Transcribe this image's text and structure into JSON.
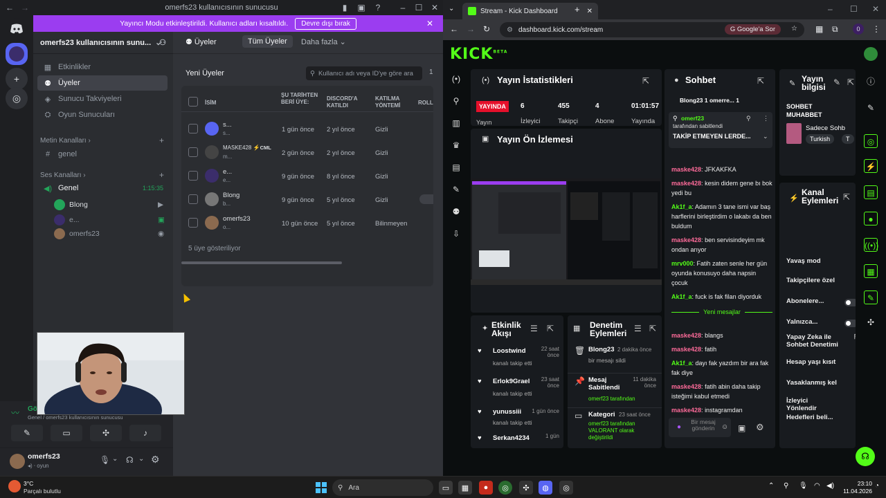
{
  "discord": {
    "window_title": "omerfs23 kullanıcısının sunucusu",
    "banner": {
      "text": "Yayıncı Modu etkinleştirildi. Kullanıcı adları kısaltıldı.",
      "button": "Devre dışı bırak"
    },
    "server_name": "omerfs23 kullanıcısının sunu...",
    "nav": [
      "Etkinlikler",
      "Üyeler",
      "Sunucu Takviyeleri",
      "Oyun Sunucuları"
    ],
    "text_category": "Metin Kanalları",
    "text_channel": "genel",
    "voice_category": "Ses Kanalları",
    "voice_channel": "Genel",
    "voice_time": "1:15:35",
    "voice_users": [
      "Blong",
      "e...",
      "omerfs23"
    ],
    "tabs": {
      "members": "Üyeler",
      "all": "Tüm Üyeler",
      "more": "Daha fazla"
    },
    "members_title": "Yeni Üyeler",
    "search_placeholder": "Kullanıcı adı veya ID'ye göre ara",
    "columns": {
      "name": "İSİM",
      "joined": "ŞU TARİHTEN BERİ ÜYE:",
      "discord": "DISCORD'A KATILDI",
      "method": "KATILMA YÖNTEMİ",
      "roles": "ROLL"
    },
    "members": [
      {
        "name": "s...",
        "sub": "s...",
        "joined": "1 gün önce",
        "discord": "2 yıl önce",
        "method": "Gizli"
      },
      {
        "name": "MASKE428",
        "sub": "m...",
        "tag": "CML",
        "joined": "2 gün önce",
        "discord": "2 yıl önce",
        "method": "Gizli"
      },
      {
        "name": "e...",
        "sub": "e...",
        "joined": "9 gün önce",
        "discord": "8 yıl önce",
        "method": "Gizli"
      },
      {
        "name": "Blong",
        "sub": "b...",
        "joined": "9 gün önce",
        "discord": "5 yıl önce",
        "method": "Gizli"
      },
      {
        "name": "omerfs23",
        "sub": "o...",
        "joined": "10 gün önce",
        "discord": "5 yıl önce",
        "method": "Bilinmeyen"
      }
    ],
    "showing": "5 üye gösteriliyor",
    "voice_panel": {
      "status": "Gö...",
      "sub": "Genel / omerfs23 kullanıcısının sunucusu"
    },
    "user": {
      "name": "omerfs23",
      "status": "oyun"
    }
  },
  "browser": {
    "tab_title": "Stream - Kick Dashboard",
    "url": "dashboard.kick.com/stream",
    "google_btn": "Google'a Sor"
  },
  "kick": {
    "logo": "KICK",
    "beta": "BETA",
    "stats": {
      "title": "Yayın İstatistikleri",
      "live": "YAYINDA",
      "viewers": "6",
      "viewers_l": "İzleyici",
      "followers": "455",
      "followers_l": "Takipçi",
      "subs": "4",
      "subs_l": "Abone",
      "duration": "01:01:57",
      "duration_l": "Yayında",
      "stream_l": "Yayın"
    },
    "preview_title": "Yayın Ön İzlemesi",
    "chat": {
      "title": "Sohbet",
      "pinned_users": "Blong23 1  omerre... 1",
      "pinned_by": "omerf23",
      "pinned_by_suffix": "tarafından sabitlendi",
      "pinned_text": "TAKİP ETMEYEN LERDE...",
      "new_messages": "Yeni mesajlar",
      "input_placeholder": "Bir mesaj gönderin",
      "messages": [
        {
          "user": "maske428",
          "text": "JFKAKFKA",
          "color": "#ff6b9a"
        },
        {
          "user": "maske428",
          "text": "kesin didem gene bı bok yedi bu",
          "color": "#ff6b9a"
        },
        {
          "user": "Ak1f_a",
          "text": "Adamın 3 tane ismi var baş harflerini birleştirdim o lakabı da ben buldum",
          "color": "#53fc18"
        },
        {
          "user": "maske428",
          "text": "ben servisindeyim mk ondan arıyor",
          "color": "#ff6b9a"
        },
        {
          "user": "mrv000",
          "text": "Fatih zaten senle her gün oyunda konusuyo daha napsin çocuk",
          "color": "#53fc18"
        },
        {
          "user": "Ak1f_a",
          "text": "fuck is fak filan diyorduk",
          "color": "#53fc18"
        },
        {
          "user": "maske428",
          "text": "blangs",
          "color": "#ff6b9a"
        },
        {
          "user": "maske428",
          "text": "fatih",
          "color": "#ff6b9a"
        },
        {
          "user": "Ak1f_a",
          "text": "dayı fak yazdım bir ara fak fak diye",
          "color": "#53fc18"
        },
        {
          "user": "maske428",
          "text": "fatih abin daha takip isteğimi kabul etmedi",
          "color": "#ff6b9a"
        },
        {
          "user": "maske428",
          "text": "instagramdan",
          "color": "#ff6b9a"
        }
      ]
    },
    "info": {
      "title": "Yayın bilgisi",
      "category": "SOHBET MUHABBET",
      "stream_name": "Sadece Sohb",
      "tag1": "Turkish",
      "tag2": "T"
    },
    "channel_actions": {
      "title": "Kanal Eylemleri",
      "items": [
        "Yavaş mod",
        "Takipçilere özel",
        "Abonelere...",
        "Yalnızca...",
        "Yapay Zeka ile Sohbet Denetimi",
        "Hesap yaşı kısıt",
        "Yasaklanmış kel",
        "İzleyici Yönlendir",
        "Hedefleri beli..."
      ]
    },
    "activity": {
      "title": "Etkinlik Akışı",
      "items": [
        {
          "user": "Loostwind",
          "action": "kanalı takip etti",
          "time": "22 saat önce"
        },
        {
          "user": "Erlok9Grael",
          "action": "kanalı takip etti",
          "time": "23 saat önce"
        },
        {
          "user": "yunussiii",
          "action": "kanalı takip etti",
          "time": "1 gün önce"
        },
        {
          "user": "Serkan4234",
          "action": "",
          "time": "1 gün"
        }
      ]
    },
    "moderation": {
      "title": "Denetim Eylemleri",
      "items": [
        {
          "user": "Blong23",
          "time": "2 dakika önce",
          "text": "bir mesajı sildi"
        },
        {
          "user": "Mesaj Sabitlendi",
          "time": "11 dakika önce",
          "text": "omerf23 tarafından"
        },
        {
          "user": "Kategori",
          "time": "23 saat önce",
          "text": "omerf23 tarafından VALORANT olarak değiştirildi"
        }
      ]
    }
  },
  "taskbar": {
    "weather_temp": "3°C",
    "weather_desc": "Parçalı bulutlu",
    "search": "Ara",
    "time": "23:10",
    "date": "11.04.2026"
  }
}
